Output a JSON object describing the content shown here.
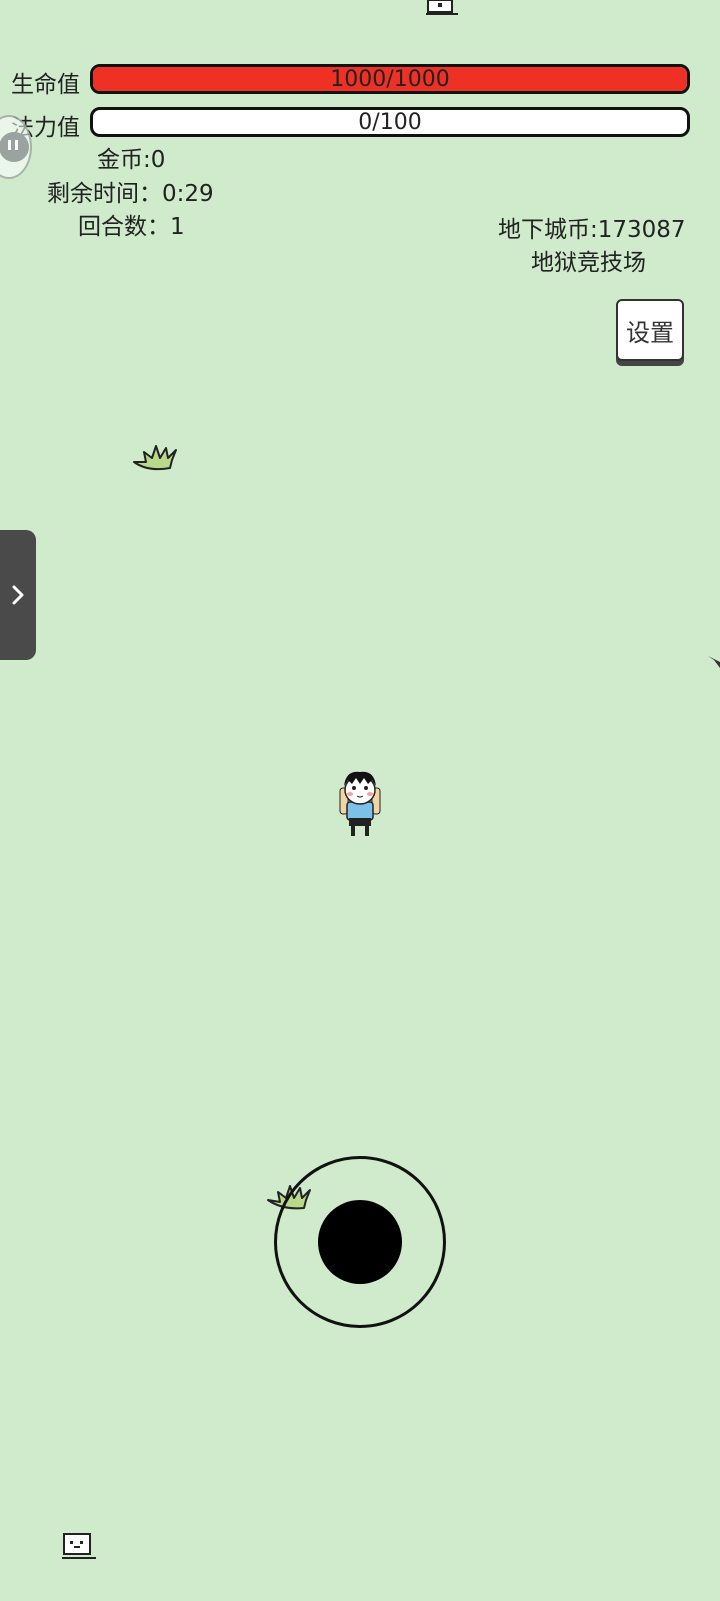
{
  "hud": {
    "hp_label": "生命值",
    "hp_value": "1000/1000",
    "hp_fraction": 1.0,
    "mp_label": "法力值",
    "mp_value": "0/100",
    "mp_fraction": 0.0,
    "gold": "金币:0",
    "time_left": "剩余时间：0:29",
    "round": "回合数：1"
  },
  "info": {
    "dungeon_coins": "地下城币:173087",
    "mode": "地狱竞技场"
  },
  "buttons": {
    "settings": "设置"
  },
  "colors": {
    "background": "#cfebcc",
    "hp_fill": "#ee3124",
    "mp_fill": "#ffffff",
    "grass": "#b8d98a"
  },
  "icons": {
    "side_tab": "chevron-right-icon",
    "float_ball": "chat-bubble-icon"
  }
}
